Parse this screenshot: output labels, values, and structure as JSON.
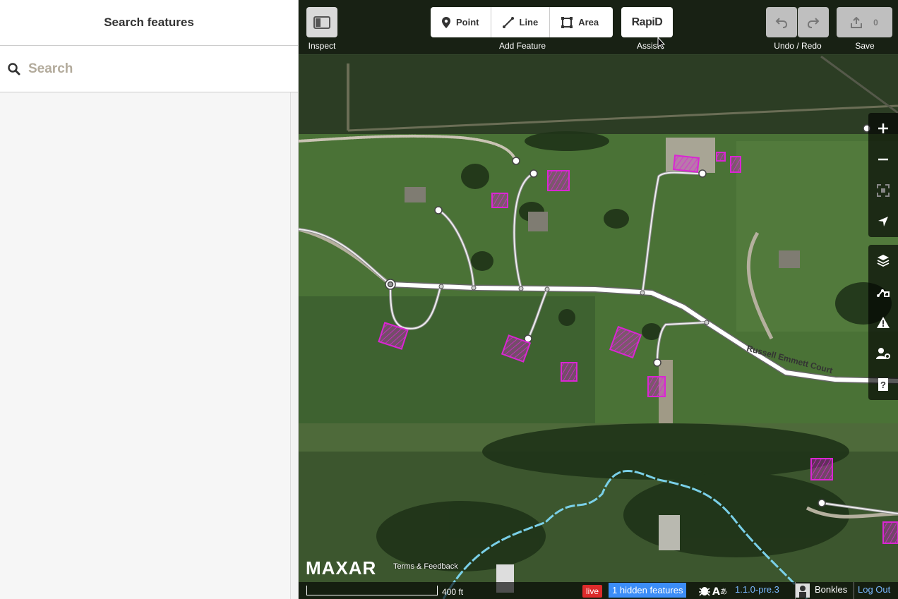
{
  "sidebar": {
    "title": "Search features",
    "search": {
      "placeholder": "Search",
      "value": ""
    }
  },
  "toolbar": {
    "inspect_label": "Inspect",
    "add_feature_label": "Add Feature",
    "point_label": "Point",
    "line_label": "Line",
    "area_label": "Area",
    "rapid_logo": "RapiD",
    "assist_label": "Assist",
    "undo_redo_label": "Undo / Redo",
    "save_label": "Save",
    "save_count": "0"
  },
  "map": {
    "road_label": "Russell Emmett Court",
    "brand": "MAXAR",
    "terms": "Terms & Feedback",
    "scale_label": "400 ft"
  },
  "footer": {
    "live": "live",
    "hidden_features": "1 hidden features",
    "version": "1.1.0-pre.3",
    "username": "Bonkles",
    "logout": "Log Out"
  },
  "colors": {
    "accent_magenta": "#da26d3",
    "live_red": "#dd2b2b",
    "hidden_blue": "#3c8df7",
    "waterway": "#7ad0e8"
  }
}
